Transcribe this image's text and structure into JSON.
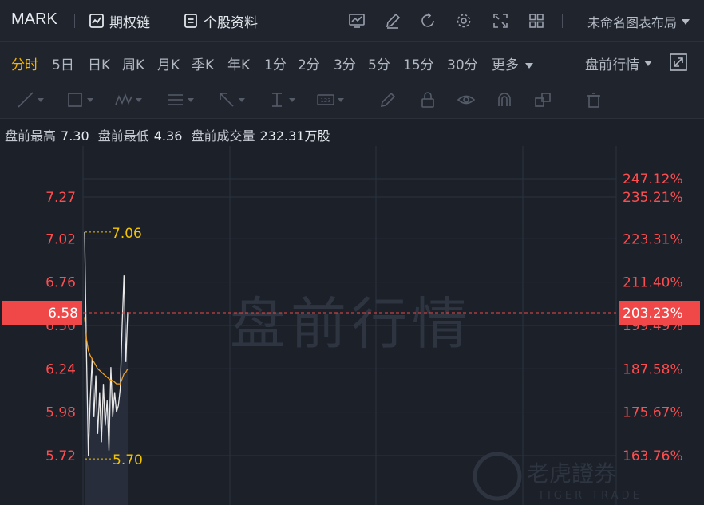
{
  "header": {
    "ticker": "MARK",
    "options_chain_label": "期权链",
    "stock_profile_label": "个股资料",
    "layout_label": "未命名图表布局"
  },
  "periods": [
    {
      "label": "分时",
      "active": true
    },
    {
      "label": "5日",
      "active": false
    },
    {
      "label": "日K",
      "active": false
    },
    {
      "label": "周K",
      "active": false
    },
    {
      "label": "月K",
      "active": false
    },
    {
      "label": "季K",
      "active": false
    },
    {
      "label": "年K",
      "active": false
    },
    {
      "label": "1分",
      "active": false
    },
    {
      "label": "2分",
      "active": false
    },
    {
      "label": "3分",
      "active": false
    },
    {
      "label": "5分",
      "active": false
    },
    {
      "label": "15分",
      "active": false
    },
    {
      "label": "30分",
      "active": false
    },
    {
      "label": "更多",
      "active": false
    }
  ],
  "session_select": "盘前行情",
  "info": {
    "high_label": "盘前最高",
    "high_value": "7.30",
    "low_label": "盘前最低",
    "low_value": "4.36",
    "volume_label": "盘前成交量",
    "volume_value": "232.31万股"
  },
  "watermark": {
    "text": "盘前行情",
    "brand": "老虎證券",
    "brand_en": "TIGER TRADE"
  },
  "colors": {
    "red": "#ff4d4f",
    "yellow": "#f5c400",
    "price_line": "#e8e8e8",
    "avg_line": "#f0a020",
    "current_bg": "#f04848"
  },
  "chart_data": {
    "type": "line",
    "current_price": "6.58",
    "current_pct": "203.23%",
    "left_ticks": [
      {
        "value": 7.27,
        "label": "7.27"
      },
      {
        "value": 7.02,
        "label": "7.02"
      },
      {
        "value": 6.76,
        "label": "6.76"
      },
      {
        "value": 6.5,
        "label": "6.50"
      },
      {
        "value": 6.24,
        "label": "6.24"
      },
      {
        "value": 5.98,
        "label": "5.98"
      },
      {
        "value": 5.72,
        "label": "5.72"
      }
    ],
    "right_ticks": [
      {
        "value": 7.38,
        "label": "247.12%"
      },
      {
        "value": 7.27,
        "label": "235.21%"
      },
      {
        "value": 7.02,
        "label": "223.31%"
      },
      {
        "value": 6.76,
        "label": "211.40%"
      },
      {
        "value": 6.5,
        "label": "199.49%"
      },
      {
        "value": 6.24,
        "label": "187.58%"
      },
      {
        "value": 5.98,
        "label": "175.67%"
      },
      {
        "value": 5.72,
        "label": "163.76%"
      }
    ],
    "annotation_high": "7.06",
    "annotation_low": "5.70",
    "ylim": [
      5.55,
      7.45
    ],
    "price_series": [
      7.06,
      6.35,
      5.72,
      6.05,
      6.3,
      5.95,
      6.2,
      5.85,
      6.1,
      5.8,
      6.15,
      5.9,
      6.05,
      5.75,
      6.25,
      5.95,
      6.1,
      5.98,
      6.02,
      6.12,
      6.5,
      6.8,
      6.28,
      6.58
    ],
    "avg_series": [
      6.55,
      6.42,
      6.35,
      6.32,
      6.3,
      6.28,
      6.26,
      6.24,
      6.23,
      6.22,
      6.21,
      6.2,
      6.19,
      6.18,
      6.17,
      6.17,
      6.16,
      6.15,
      6.15,
      6.15,
      6.18,
      6.21,
      6.22,
      6.24
    ]
  }
}
